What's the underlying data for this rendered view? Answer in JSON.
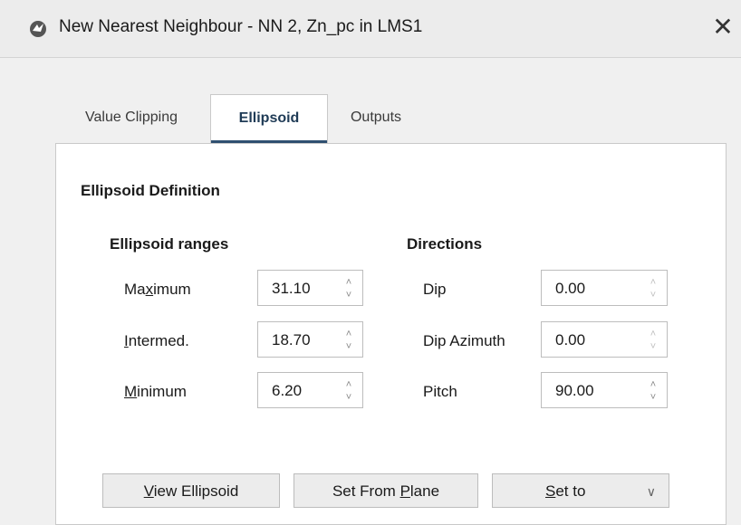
{
  "window": {
    "title": "New Nearest Neighbour - NN 2, Zn_pc in LMS1",
    "close_glyph": "✕"
  },
  "tabs": [
    {
      "label": "Value Clipping",
      "active": false
    },
    {
      "label": "Ellipsoid",
      "active": true
    },
    {
      "label": "Outputs",
      "active": false
    }
  ],
  "ellipsoid": {
    "section_title": "Ellipsoid Definition",
    "ranges": {
      "title": "Ellipsoid ranges",
      "maximum": {
        "pre": "Ma",
        "ul": "x",
        "post": "imum",
        "value": "31.10"
      },
      "intermediate": {
        "pre": "",
        "ul": "I",
        "post": "ntermed.",
        "value": "18.70"
      },
      "minimum": {
        "pre": "",
        "ul": "M",
        "post": "inimum",
        "value": "6.20"
      }
    },
    "directions": {
      "title": "Directions",
      "dip": {
        "label": "Dip",
        "value": "0.00"
      },
      "dip_azimuth": {
        "label": "Dip Azimuth",
        "value": "0.00"
      },
      "pitch": {
        "label": "Pitch",
        "value": "90.00"
      }
    }
  },
  "buttons": {
    "view_ellipsoid": {
      "ul": "V",
      "rest": "iew Ellipsoid"
    },
    "set_from_plane": {
      "pre": "Set From ",
      "ul": "P",
      "rest": "lane"
    },
    "set_to": {
      "ul": "S",
      "rest": "et to"
    }
  },
  "icons": {
    "spin_up": "^",
    "spin_down": "v",
    "dropdown": "chevron-down"
  }
}
